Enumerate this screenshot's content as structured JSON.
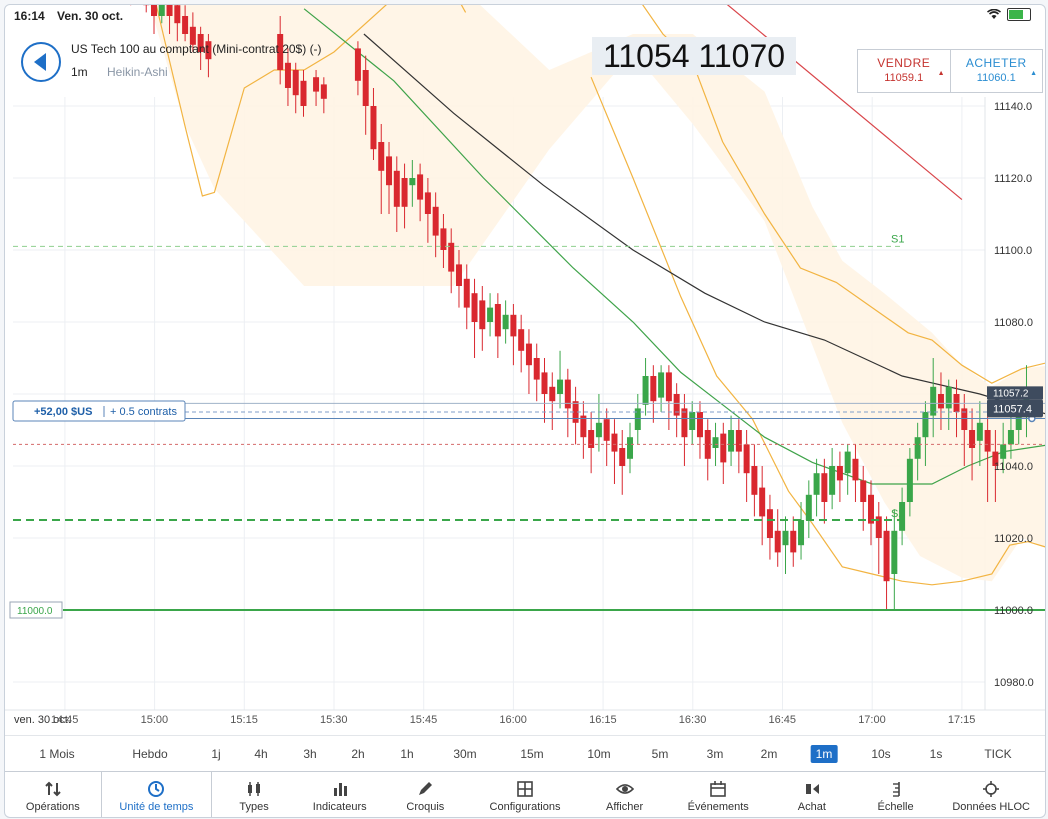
{
  "status": {
    "time": "16:14",
    "date": "Ven. 30 oct."
  },
  "header": {
    "instrument": "US Tech 100 au comptant (Mini-contrat 20$) (-)",
    "timeframe": "1m",
    "chart_type": "Heikin-Ashi",
    "price_box": "11054 11070"
  },
  "trade": {
    "sell_label": "VENDRE",
    "sell_price": "11059.1",
    "buy_label": "ACHETER",
    "buy_price": "11060.1"
  },
  "position": {
    "pnl": "+52,00 $US",
    "contracts": "+ 0.5 contrats"
  },
  "chart": {
    "current_price_label": "11057.4",
    "hidden_price_label": "11057.2",
    "level_label": "11000.0",
    "s1": "S1",
    "s2": "S2",
    "y_ticks": [
      "11140.0",
      "11120.0",
      "11100.0",
      "11080.0",
      "11060.0",
      "11040.0",
      "11020.0",
      "11000.0",
      "10980.0"
    ],
    "x_date": "ven. 30 oct.",
    "x_ticks": [
      "14:45",
      "15:00",
      "15:15",
      "15:30",
      "15:45",
      "16:00",
      "16:15",
      "16:30",
      "16:45",
      "17:00",
      "17:15"
    ]
  },
  "timeframes": [
    "1 Mois",
    "Hebdo",
    "1j",
    "4h",
    "3h",
    "2h",
    "1h",
    "30m",
    "15m",
    "10m",
    "5m",
    "3m",
    "2m",
    "1m",
    "10s",
    "1s",
    "TICK"
  ],
  "selected_timeframe": "1m",
  "toolbar": [
    "Opérations",
    "Unité de temps",
    "Types",
    "Indicateurs",
    "Croquis",
    "Configurations",
    "Afficher",
    "Événements",
    "Achat",
    "Échelle",
    "Données HLOC"
  ],
  "colors": {
    "up": "#3aa64a",
    "down": "#d9282f",
    "accent": "#1e6fc7",
    "band": "#f2b442",
    "mid": "#3fa34a",
    "ma": "#333333",
    "trend": "#d9454a"
  },
  "chart_data": {
    "type": "candlestick",
    "title": "US Tech 100 au comptant (Mini-contrat 20$) (-)",
    "ylim": [
      10970,
      11150
    ],
    "levels": {
      "S1": 11101,
      "S2": 11025,
      "position_entry": 11055,
      "support": 11000,
      "current": 11057.4
    },
    "x_range": [
      "14:40",
      "17:20"
    ]
  }
}
